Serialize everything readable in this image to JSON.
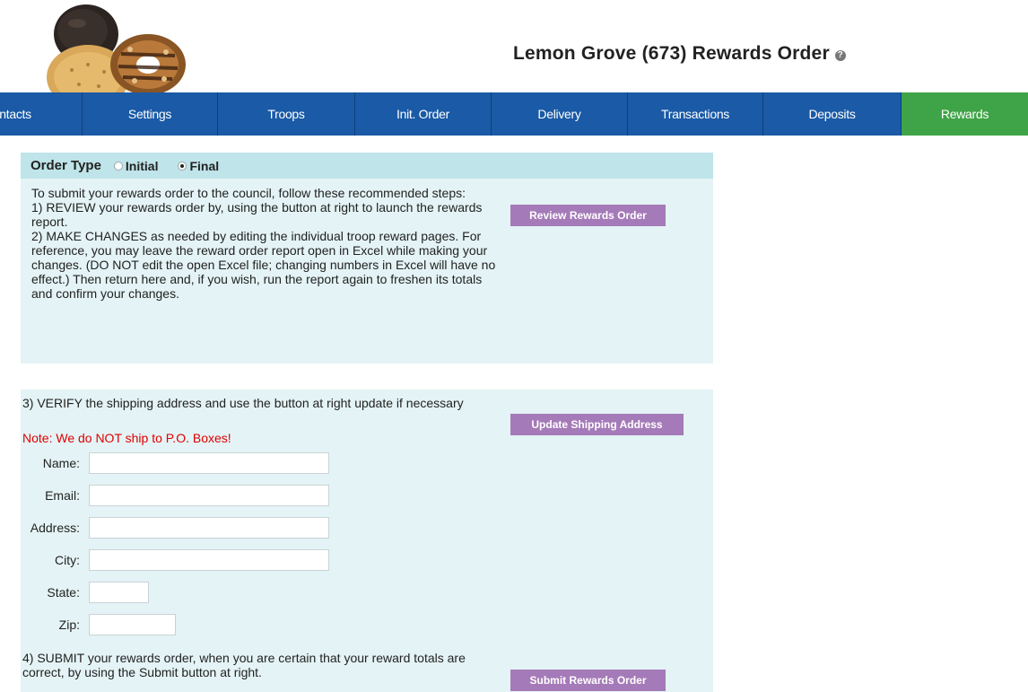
{
  "header": {
    "title": "Lemon Grove (673) Rewards Order",
    "help_icon": "?"
  },
  "nav": {
    "items": [
      {
        "label": "Contacts",
        "active": false
      },
      {
        "label": "Settings",
        "active": false
      },
      {
        "label": "Troops",
        "active": false
      },
      {
        "label": "Init. Order",
        "active": false
      },
      {
        "label": "Delivery",
        "active": false
      },
      {
        "label": "Transactions",
        "active": false
      },
      {
        "label": "Deposits",
        "active": false
      },
      {
        "label": "Rewards",
        "active": true
      }
    ],
    "colors": {
      "bar": "#1a5aa6",
      "active": "#3fa447"
    }
  },
  "order_type": {
    "label": "Order Type",
    "options": [
      {
        "label": "Initial",
        "selected": false
      },
      {
        "label": "Final",
        "selected": true
      }
    ]
  },
  "instructions": {
    "intro": "To submit your rewards order to the council, follow these recommended steps:",
    "step1": "1) REVIEW your rewards order by, using the button at right to launch the rewards report.",
    "step2": "2) MAKE CHANGES as needed by editing the individual troop reward pages. For reference, you may leave the reward order report open in Excel while making your changes. (DO NOT edit the open Excel file; changing numbers in Excel will have no effect.) Then return here and, if you wish, run the report again to freshen its totals and confirm your changes."
  },
  "buttons": {
    "review": "Review Rewards Order",
    "update_shipping": "Update Shipping Address",
    "submit": "Submit Rewards Order",
    "color": "#a57ab8"
  },
  "shipping": {
    "step3": "3) VERIFY the shipping address and use the button at right update if necessary",
    "po_note": "Note: We do NOT ship to P.O. Boxes!",
    "fields": {
      "name": {
        "label": "Name:",
        "value": ""
      },
      "email": {
        "label": "Email:",
        "value": ""
      },
      "address": {
        "label": "Address:",
        "value": ""
      },
      "city": {
        "label": "City:",
        "value": ""
      },
      "state": {
        "label": "State:",
        "value": ""
      },
      "zip": {
        "label": "Zip:",
        "value": ""
      }
    }
  },
  "submit": {
    "step4": "4) SUBMIT your rewards order, when you are certain that your reward totals are correct, by using the Submit button at right."
  }
}
